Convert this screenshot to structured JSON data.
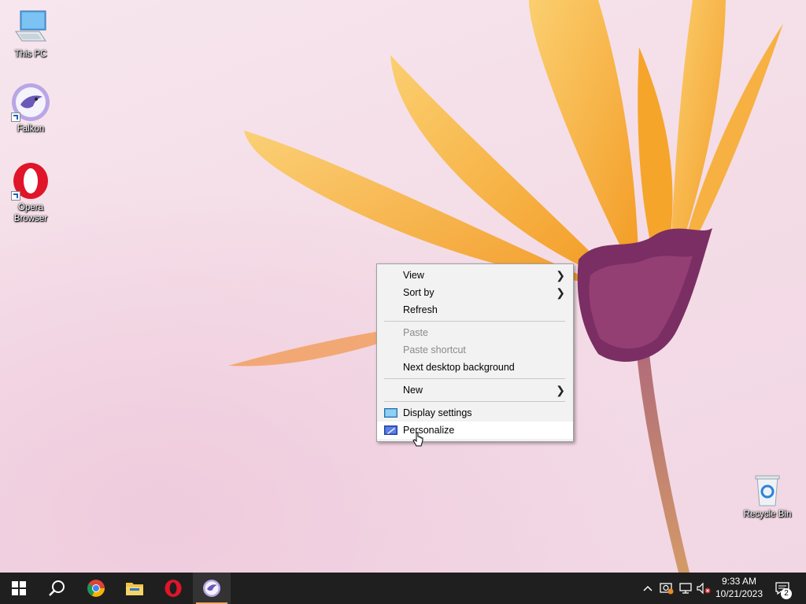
{
  "desktop": {
    "icons": [
      {
        "label": "This PC",
        "icon": "this-pc-icon"
      },
      {
        "label": "Falkon",
        "icon": "falkon-icon"
      },
      {
        "label": "Opera Browser",
        "icon": "opera-icon"
      },
      {
        "label": "Recycle Bin",
        "icon": "recycle-bin-icon"
      }
    ]
  },
  "context_menu": {
    "items": [
      {
        "label": "View",
        "submenu": true,
        "enabled": true
      },
      {
        "label": "Sort by",
        "submenu": true,
        "enabled": true
      },
      {
        "label": "Refresh",
        "submenu": false,
        "enabled": true
      },
      {
        "label": "Paste",
        "submenu": false,
        "enabled": false
      },
      {
        "label": "Paste shortcut",
        "submenu": false,
        "enabled": false
      },
      {
        "label": "Next desktop background",
        "submenu": false,
        "enabled": true
      },
      {
        "label": "New",
        "submenu": true,
        "enabled": true
      },
      {
        "label": "Display settings",
        "submenu": false,
        "enabled": true,
        "icon": "display-settings-icon"
      },
      {
        "label": "Personalize",
        "submenu": false,
        "enabled": true,
        "icon": "personalize-icon",
        "highlighted": true
      }
    ]
  },
  "taskbar": {
    "pinned": [
      "start-icon",
      "search-icon",
      "chrome-icon",
      "file-explorer-icon",
      "opera-icon",
      "falkon-icon"
    ],
    "active_app": "falkon",
    "tray_icons": [
      "chevron-up-icon",
      "security-icon",
      "network-icon",
      "volume-muted-icon"
    ],
    "clock": {
      "time": "9:33 AM",
      "date": "10/21/2023"
    },
    "notifications": {
      "count": "2"
    }
  },
  "colors": {
    "taskbar": "#1f1f1f",
    "menu_bg": "#f2f2f2",
    "petal": "#f7ad35",
    "stem": "#c9836f"
  }
}
